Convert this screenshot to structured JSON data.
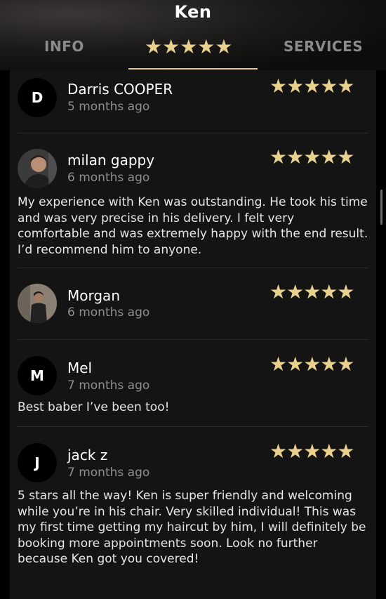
{
  "header": {
    "title": "Ken",
    "tabs": {
      "info": "INFO",
      "rating": "★★★★★",
      "services": "SERVICES"
    }
  },
  "reviews": [
    {
      "avatar_letter": "D",
      "name": "Darris COOPER",
      "date": "5 months ago",
      "stars": "★★★★★",
      "text": ""
    },
    {
      "avatar_letter": "",
      "avatar_type": "photo",
      "name": "milan gappy",
      "date": "6 months ago",
      "stars": "★★★★★",
      "text": "My experience with Ken was outstanding. He took his time and was very precise in his delivery. I felt very comfortable and was extremely happy with the end result. I’d recommend him to anyone."
    },
    {
      "avatar_letter": "",
      "avatar_type": "photo",
      "name": "Morgan",
      "date": "6 months ago",
      "stars": "★★★★★",
      "text": ""
    },
    {
      "avatar_letter": "M",
      "name": "Mel",
      "date": "7 months ago",
      "stars": "★★★★★",
      "text": "Best baber I’ve been too!"
    },
    {
      "avatar_letter": "J",
      "name": "jack z",
      "date": "7 months ago",
      "stars": "★★★★★",
      "text": "5 stars all the way! Ken is super friendly and welcoming while you’re in his chair. Very skilled individual! This was my first time getting my haircut by him, I will definitely be booking more appointments soon. Look no further because Ken got you covered!"
    }
  ],
  "colors": {
    "star": "#e8d08e",
    "accent_underline": "#e3c98a",
    "panel_bg": "#141414",
    "date_text": "#8f8f8f"
  }
}
